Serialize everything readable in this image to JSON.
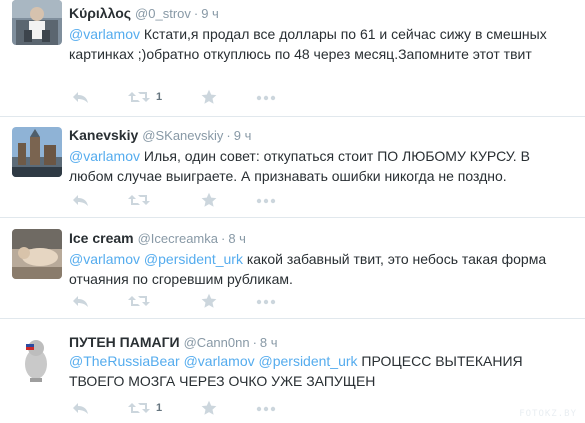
{
  "tweets": [
    {
      "fullname": "Κύριλλος",
      "username": "@0_strov",
      "time": "9 ч",
      "text_parts": [
        {
          "type": "mention",
          "text": "@varlamov"
        },
        {
          "type": "text",
          "text": " Кстати,я продал все доллары по 61 и сейчас сижу в смешных картинках ;)обратно откуплюсь по 48 через месяц.Запомните этот твит"
        }
      ],
      "retweet_count": "1"
    },
    {
      "fullname": "Kanevskiy",
      "username": "@SKanevskiy",
      "time": "9 ч",
      "text_parts": [
        {
          "type": "mention",
          "text": "@varlamov"
        },
        {
          "type": "text",
          "text": " Илья, один совет: откупаться стоит ПО ЛЮБОМУ КУРСУ. В любом случае выиграете. А признавать ошибки никогда не поздно."
        }
      ],
      "retweet_count": ""
    },
    {
      "fullname": "Ice cream",
      "username": "@Icecreamka",
      "time": "8 ч",
      "text_parts": [
        {
          "type": "mention",
          "text": "@varlamov"
        },
        {
          "type": "text",
          "text": " "
        },
        {
          "type": "mention",
          "text": "@persident_urk"
        },
        {
          "type": "text",
          "text": " какой забавный твит, это небось такая форма отчаяния по сгоревшим рубликам."
        }
      ],
      "retweet_count": ""
    },
    {
      "fullname": "ПУТЕН ПАМАГИ",
      "username": "@Cann0nn",
      "time": "8 ч",
      "text_parts": [
        {
          "type": "mention",
          "text": "@TheRussiaBear"
        },
        {
          "type": "text",
          "text": " "
        },
        {
          "type": "mention",
          "text": "@varlamov"
        },
        {
          "type": "text",
          "text": " "
        },
        {
          "type": "mention",
          "text": "@persident_urk"
        },
        {
          "type": "text",
          "text": " ПРОЦЕСС ВЫТЕКАНИЯ ТВОЕГО МОЗГА ЧЕРЕЗ ОЧКО УЖЕ ЗАПУЩЕН"
        }
      ],
      "retweet_count": "1"
    }
  ],
  "icons": {
    "reply": "reply-icon",
    "retweet": "retweet-icon",
    "favorite": "star-icon",
    "more": "more-dots-icon"
  },
  "colors": {
    "mention": "#55acee",
    "meta": "#8899a6",
    "action_icon": "#ccd6dd",
    "separator": "#e1e8ed",
    "text": "#292f33"
  },
  "watermark": "FOTOKZ.BY"
}
